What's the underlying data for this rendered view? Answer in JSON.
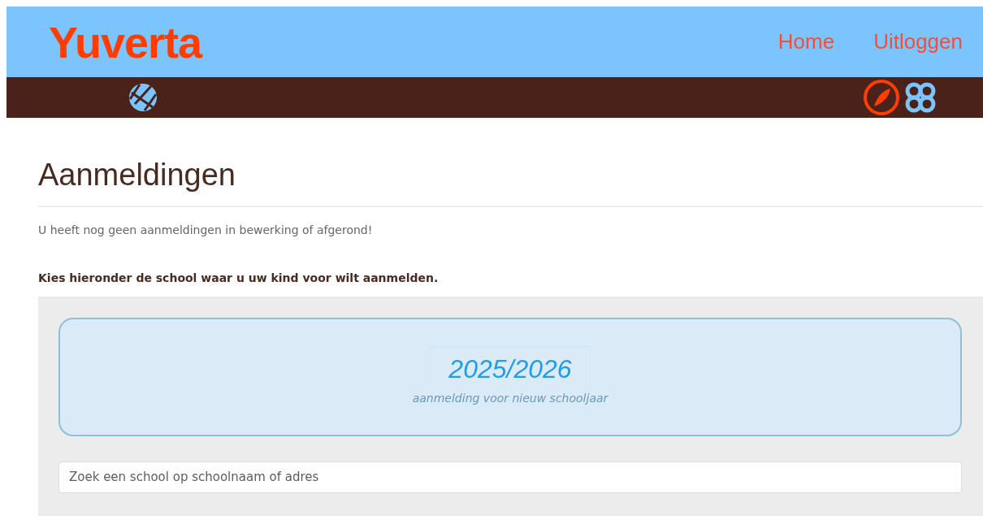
{
  "header": {
    "logo": "Yuverta",
    "nav": [
      {
        "label": "Home"
      },
      {
        "label": "Uitloggen"
      }
    ]
  },
  "page": {
    "title": "Aanmeldingen",
    "message": "U heeft nog geen aanmeldingen in bewerking of afgerond!",
    "instruction": "Kies hieronder de school waar u uw kind voor wilt aanmelden."
  },
  "year_card": {
    "year": "2025/2026",
    "subtitle": "aanmelding voor nieuw schooljaar"
  },
  "search": {
    "placeholder": "Zoek een school op schoolnaam of adres"
  }
}
